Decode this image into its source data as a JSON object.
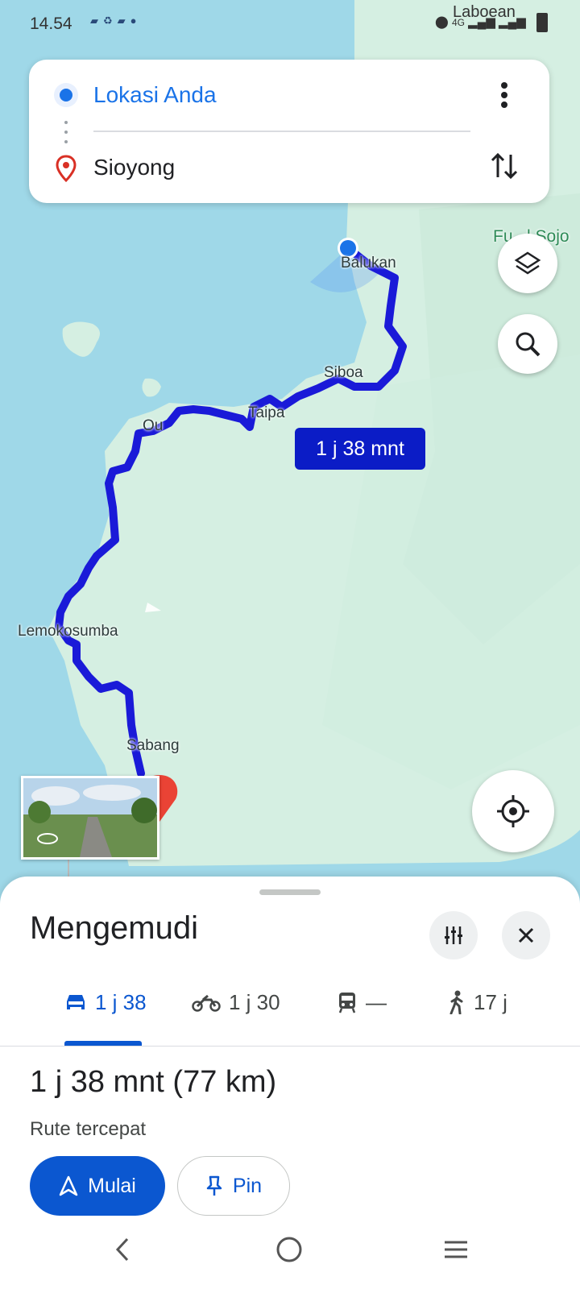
{
  "status_bar": {
    "time": "14.54",
    "carrier": "Laboean",
    "network": "4G",
    "left_icons": [
      "notification-icon",
      "sync-icon",
      "notification-icon",
      "dot-icon"
    ],
    "right_icons": [
      "location-icon",
      "signal-icon",
      "signal-icon",
      "battery-icon"
    ]
  },
  "route_card": {
    "origin": "Lokasi Anda",
    "destination": "Sioyong"
  },
  "map": {
    "places": [
      "Balukan",
      "Siboa",
      "Taipa",
      "Ou",
      "Lemokosumba",
      "Sabang",
      "Laboean",
      "Fu...l Sojo"
    ],
    "eta_label": "1 j 38 mnt"
  },
  "sheet": {
    "title": "Mengemudi",
    "modes": [
      {
        "icon": "car-icon",
        "label": "1 j 38",
        "active": true
      },
      {
        "icon": "motorcycle-icon",
        "label": "1 j 30",
        "active": false
      },
      {
        "icon": "transit-icon",
        "label": "—",
        "active": false
      },
      {
        "icon": "walk-icon",
        "label": "17 j",
        "active": false
      }
    ],
    "summary": "1 j 38 mnt (77 km)",
    "subtitle": "Rute tercepat",
    "start_label": "Mulai",
    "pin_label": "Pin"
  },
  "colors": {
    "accent": "#0b57d0",
    "route": "#1a35f0",
    "water": "#9fd8e8",
    "land": "#d5efe2",
    "destination_marker": "#ea4335"
  }
}
